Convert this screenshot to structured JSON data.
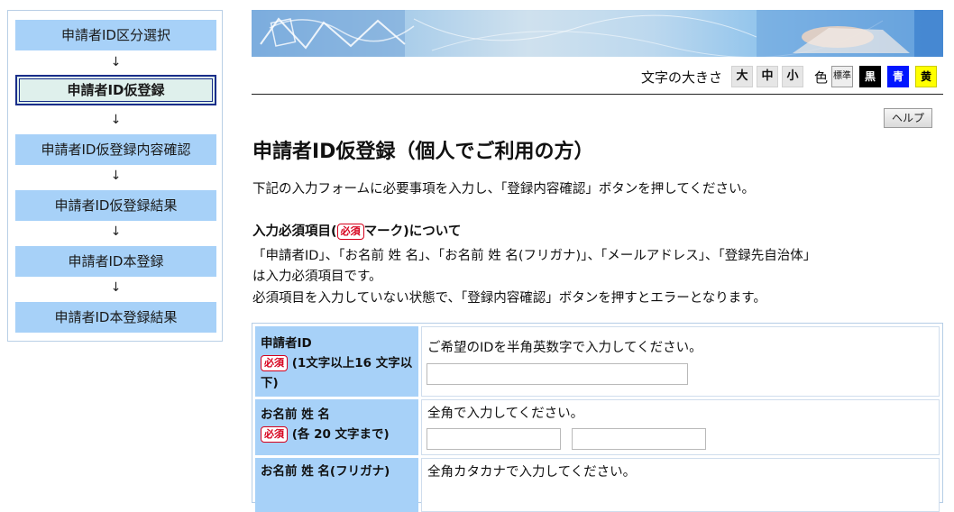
{
  "steps": [
    {
      "label": "申請者ID区分選択"
    },
    {
      "label": "申請者ID仮登録"
    },
    {
      "label": "申請者ID仮登録内容確認"
    },
    {
      "label": "申請者ID仮登録結果"
    },
    {
      "label": "申請者ID本登録"
    },
    {
      "label": "申請者ID本登録結果"
    }
  ],
  "step_arrow": "↓",
  "controls": {
    "text_size_label": "文字の大きさ",
    "sizes": [
      "大",
      "中",
      "小"
    ],
    "color_label": "色",
    "colors": {
      "standard": "標準",
      "black": "黒",
      "blue": "青",
      "yellow": "黄"
    }
  },
  "help_label": "ヘルプ",
  "title": "申請者ID仮登録（個人でご利用の方）",
  "intro": "下記の入力フォームに必要事項を入力し、「登録内容確認」ボタンを押してください。",
  "req_note": {
    "head_pre": "入力必須項目(",
    "head_post": "マーク)について",
    "line1": "「申請者ID」、「お名前 姓 名」、「お名前 姓 名(フリガナ)」、「メールアドレス」、「登録先自治体」",
    "line2": "は入力必須項目です。",
    "line3": "必須項目を入力していない状態で、「登録内容確認」ボタンを押すとエラーとなります。"
  },
  "required_badge": "必須",
  "form": {
    "applicant_id": {
      "label": "申請者ID",
      "note": "(1文字以上16 文字以下)",
      "hint": "ご希望のIDを半角英数字で入力してください。",
      "value": ""
    },
    "name": {
      "label": "お名前 姓 名",
      "note": "(各 20 文字まで)",
      "hint": "全角で入力してください。",
      "last_value": "",
      "first_value": ""
    },
    "name_kana": {
      "label": "お名前 姓 名(フリガナ)",
      "hint": "全角カタカナで入力してください。"
    }
  },
  "colors": {
    "step_bg": "#a7d1f8",
    "step_current_bg": "#dff0ec",
    "required_red": "#d6001c",
    "header_bg": "#a7d1f8"
  }
}
